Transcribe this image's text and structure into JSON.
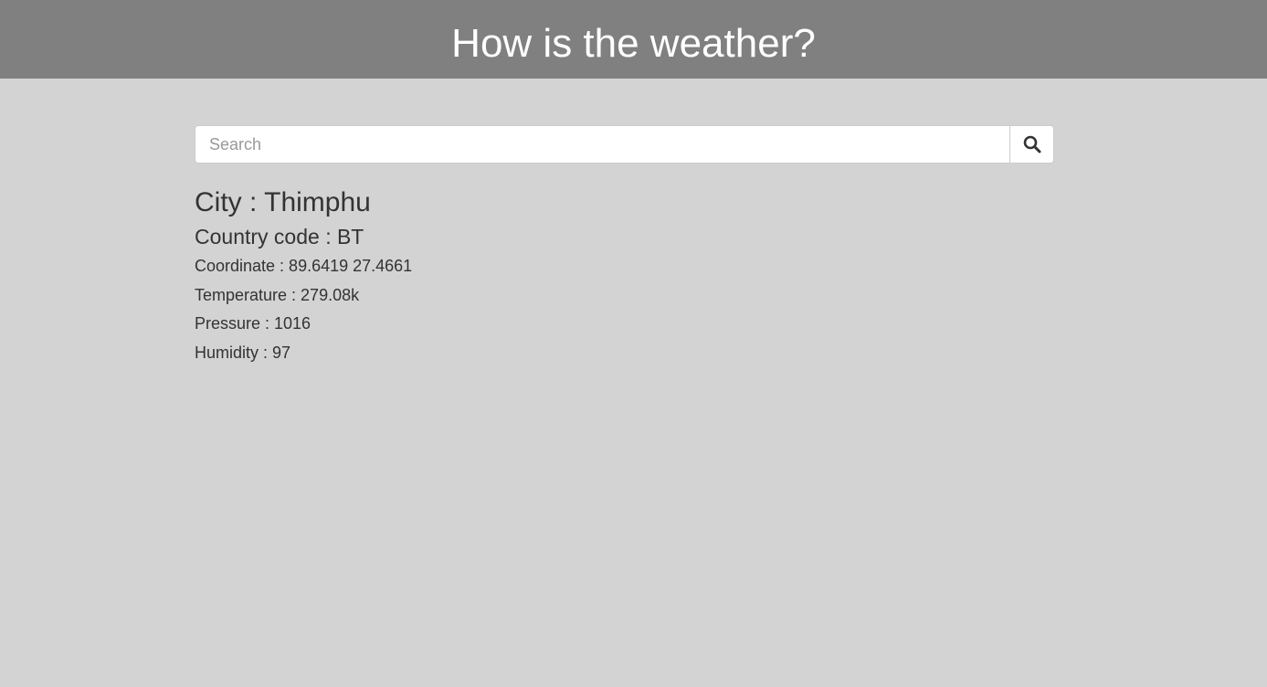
{
  "header": {
    "title": "How is the weather?"
  },
  "search": {
    "placeholder": "Search",
    "value": "",
    "button_icon": "search-icon"
  },
  "result": {
    "city": "City : Thimphu",
    "country": "Country code : BT",
    "coordinate": "Coordinate : 89.6419 27.4661",
    "temperature": "Temperature : 279.08k",
    "pressure": "Pressure : 1016",
    "humidity": "Humidity : 97"
  },
  "colors": {
    "header_bg": "#808080",
    "page_bg": "#d3d3d3",
    "text": "#333333",
    "header_text": "#ffffff"
  }
}
